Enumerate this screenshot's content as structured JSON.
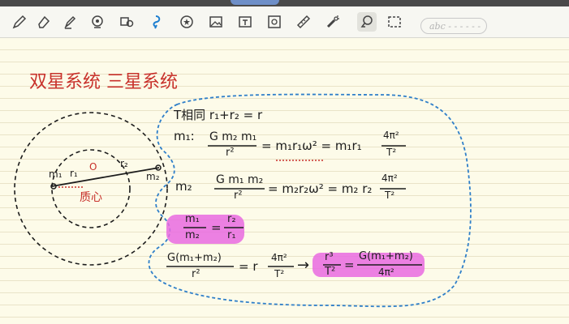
{
  "toolbar": {
    "search_placeholder": "abc - - - - - -",
    "tools": [
      {
        "name": "pen-icon"
      },
      {
        "name": "eraser-icon"
      },
      {
        "name": "highlighter-icon"
      },
      {
        "name": "shape-icon"
      },
      {
        "name": "lasso-icon"
      },
      {
        "name": "lasso-active-icon"
      },
      {
        "name": "sticker-icon"
      },
      {
        "name": "image-icon"
      },
      {
        "name": "textbox-icon"
      },
      {
        "name": "scan-icon"
      },
      {
        "name": "ruler-icon"
      },
      {
        "name": "laser-icon"
      },
      {
        "name": "selection-tool-icon"
      },
      {
        "name": "select-rect-icon"
      }
    ]
  },
  "note": {
    "title": "双星系统 三星系统",
    "line1": "T相同   r₁+r₂ = r",
    "m1_label": "m₁:",
    "m1_eq_left": "G m₂ m₁",
    "m1_eq_den": "r²",
    "m1_eq_mid": "= m₁r₁ω² = m₁r₁",
    "m1_eq_right_num": "4π²",
    "m1_eq_right_den": "T²",
    "m2_label": "m₂",
    "m2_eq_left": "G m₁ m₂",
    "m2_eq_den": "r²",
    "m2_eq_mid": "= m₂r₂ω² = m₂ r₂",
    "m2_eq_right_num": "4π²",
    "m2_eq_right_den": "T²",
    "ratio_num": "m₁",
    "ratio_den": "m₂",
    "ratio_eq": "=",
    "ratio_r_num": "r₂",
    "ratio_r_den": "r₁",
    "final_left_num": "G(m₁+m₂)",
    "final_left_den": "r²",
    "final_mid": "= r",
    "final_mid_num": "4π²",
    "final_mid_den": "T²",
    "final_arrow": "→",
    "final_r3": "r³",
    "final_T2": "T²",
    "final_eq": "=",
    "final_right_num": "G(m₁+m₂)",
    "final_right_den": "4π²",
    "diag_m1": "m₁",
    "diag_r1": "r₁",
    "diag_O": "O",
    "diag_r2": "r₂",
    "diag_m2": "m₂",
    "diag_center": "质心"
  },
  "colors": {
    "red_ink": "#c8312b",
    "black_ink": "#1c1c1c",
    "blue_dash": "#2f7fc9",
    "highlight": "#e96ae0"
  }
}
